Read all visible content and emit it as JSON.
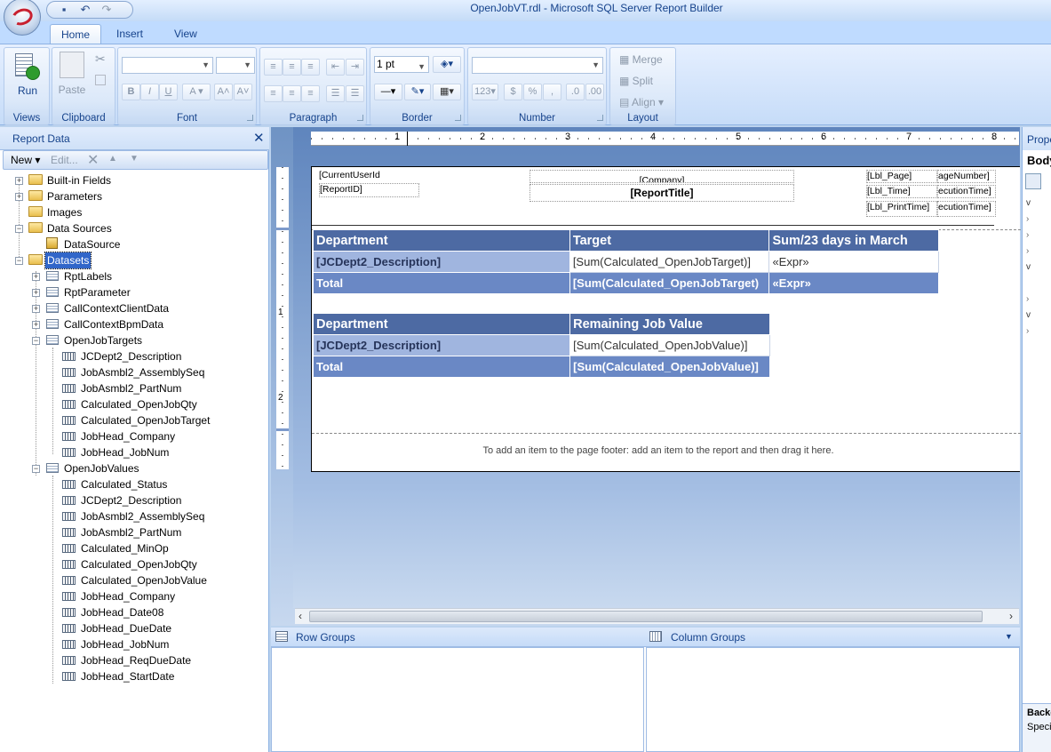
{
  "window": {
    "title": "OpenJobVT.rdl - Microsoft SQL Server Report Builder"
  },
  "tabs": [
    "Home",
    "Insert",
    "View"
  ],
  "ribbon": {
    "groups": {
      "views": "Views",
      "clipboard": "Clipboard",
      "font": "Font",
      "paragraph": "Paragraph",
      "border": "Border",
      "number": "Number",
      "layout": "Layout"
    },
    "run_label": "Run",
    "paste_label": "Paste",
    "border_width": "1 pt",
    "merge_label": "Merge",
    "split_label": "Split",
    "align_label": "Align"
  },
  "report_data": {
    "title": "Report Data",
    "new_label": "New",
    "edit_label": "Edit...",
    "tree": {
      "builtin": "Built-in Fields",
      "parameters": "Parameters",
      "images": "Images",
      "datasources": "Data Sources",
      "datasource": "DataSource",
      "datasets": "Datasets",
      "rptlabels": "RptLabels",
      "rptparameter": "RptParameter",
      "ccclient": "CallContextClientData",
      "ccbpm": "CallContextBpmData",
      "openjobtargets": "OpenJobTargets",
      "targets_fields": [
        "JCDept2_Description",
        "JobAsmbl2_AssemblySeq",
        "JobAsmbl2_PartNum",
        "Calculated_OpenJobQty",
        "Calculated_OpenJobTarget",
        "JobHead_Company",
        "JobHead_JobNum"
      ],
      "openjobvalues": "OpenJobValues",
      "values_fields": [
        "Calculated_Status",
        "JCDept2_Description",
        "JobAsmbl2_AssemblySeq",
        "JobAsmbl2_PartNum",
        "Calculated_MinOp",
        "Calculated_OpenJobQty",
        "Calculated_OpenJobValue",
        "JobHead_Company",
        "JobHead_Date08",
        "JobHead_DueDate",
        "JobHead_JobNum",
        "JobHead_ReqDueDate",
        "JobHead_StartDate"
      ]
    }
  },
  "ruler": {
    "marks": [
      "1",
      "2",
      "3",
      "4",
      "5",
      "6",
      "7",
      "8"
    ],
    "vmarks": [
      "1",
      "2"
    ]
  },
  "report": {
    "current_user": "[CurrentUserId",
    "report_id": "[ReportID]",
    "company": "[Company]",
    "report_title": "[ReportTitle]",
    "lbl_page": "[Lbl_Page]",
    "page_number": "ageNumber]",
    "lbl_time": "[Lbl_Time]",
    "exec_time": "ecutionTime]",
    "lbl_printtime": "[Lbl_PrintTime]",
    "exec_time2": "ecutionTime]",
    "table1": {
      "headers": [
        "Department",
        "Target",
        "Sum/23 days in March"
      ],
      "row": [
        "[JCDept2_Description]",
        "[Sum(Calculated_OpenJobTarget)]",
        "«Expr»"
      ],
      "total": [
        "Total",
        "[Sum(Calculated_OpenJobTarget)",
        "«Expr»"
      ]
    },
    "table2": {
      "headers": [
        "Department",
        "Remaining Job Value"
      ],
      "row": [
        "[JCDept2_Description]",
        "[Sum(Calculated_OpenJobValue)]"
      ],
      "total": [
        "Total",
        "[Sum(Calculated_OpenJobValue)]"
      ]
    },
    "footer_hint": "To add an item to the page footer: add an item to the report and then drag it here."
  },
  "groups": {
    "row": "Row Groups",
    "column": "Column Groups"
  },
  "properties": {
    "title": "Prope",
    "subject": "Body",
    "bottom1": "Backg",
    "bottom2": "Speci"
  }
}
